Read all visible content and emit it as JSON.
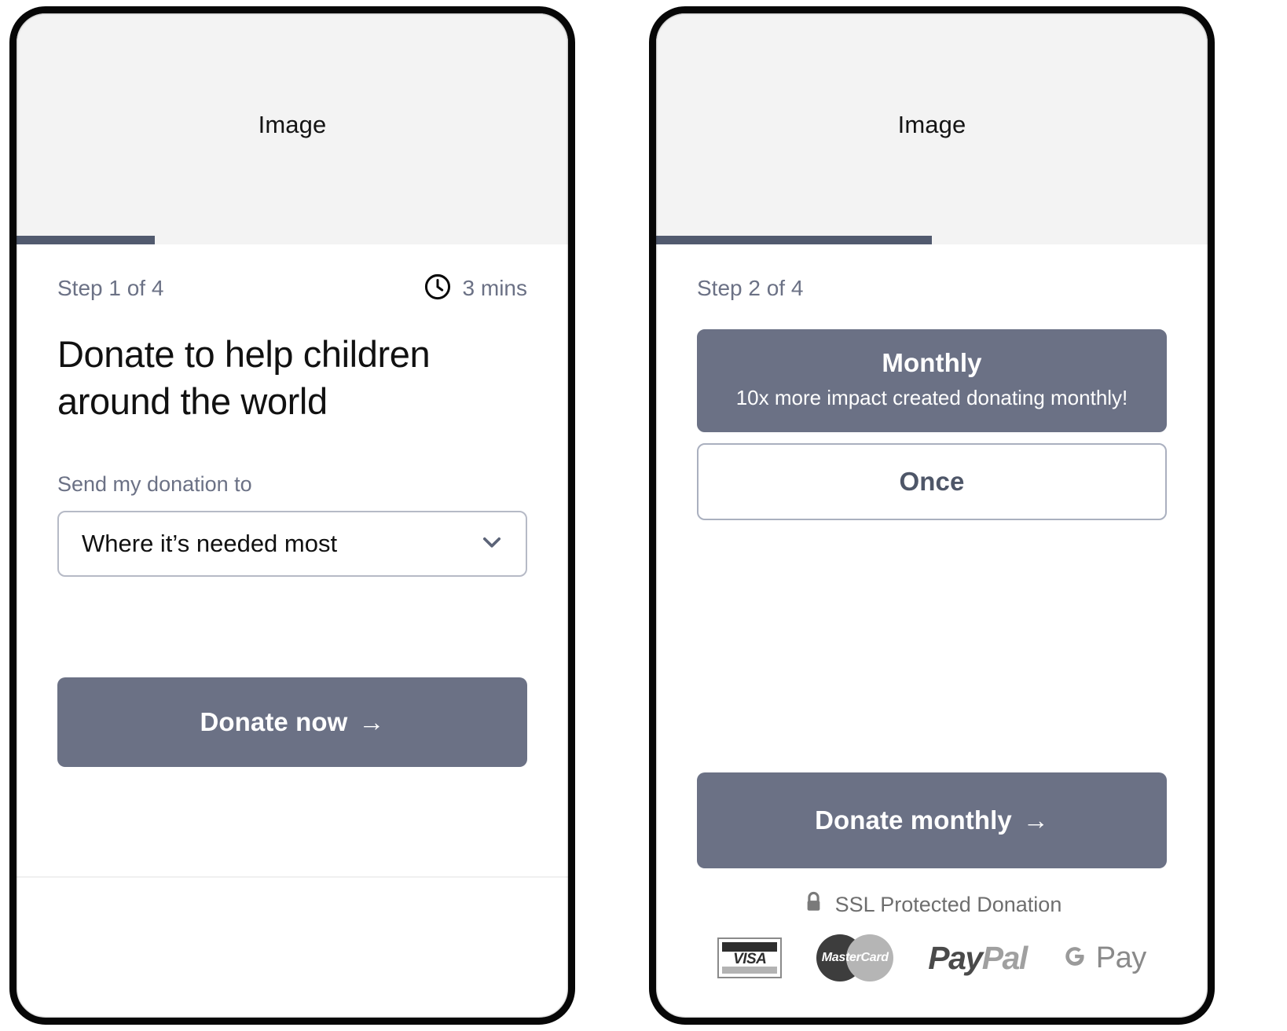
{
  "theme": {
    "accent": "#6b7185",
    "progress_fill": "#515a6e",
    "image_placeholder_bg": "#f3f3f3",
    "muted_text": "#6b7185",
    "border": "#b6bac6"
  },
  "screens": [
    {
      "id": "step-1",
      "image_placeholder": "Image",
      "progress_percent": 25,
      "step_label": "Step 1 of 4",
      "time_estimate": "3 mins",
      "clock_icon": "clock-icon",
      "headline": "Donate to help children around the world",
      "field": {
        "label": "Send my donation to",
        "value": "Where it’s needed most",
        "chevron_icon": "chevron-down-icon"
      },
      "cta": {
        "label": "Donate now",
        "arrow": "→"
      }
    },
    {
      "id": "step-2",
      "image_placeholder": "Image",
      "progress_percent": 50,
      "step_label": "Step 2 of 4",
      "frequency_options": [
        {
          "title": "Monthly",
          "subtitle": "10x more impact created donating monthly!",
          "selected": true
        },
        {
          "title": "Once",
          "subtitle": "",
          "selected": false
        }
      ],
      "cta": {
        "label": "Donate monthly",
        "arrow": "→"
      },
      "trust": {
        "lock_icon": "lock-icon",
        "ssl_text": "SSL Protected Donation",
        "payment_methods": [
          {
            "name": "visa-logo",
            "label": "VISA"
          },
          {
            "name": "mastercard-logo",
            "label": "MasterCard"
          },
          {
            "name": "paypal-logo",
            "label_part1": "Pay",
            "label_part2": "Pal"
          },
          {
            "name": "gpay-logo",
            "label": "Pay"
          }
        ]
      }
    }
  ]
}
